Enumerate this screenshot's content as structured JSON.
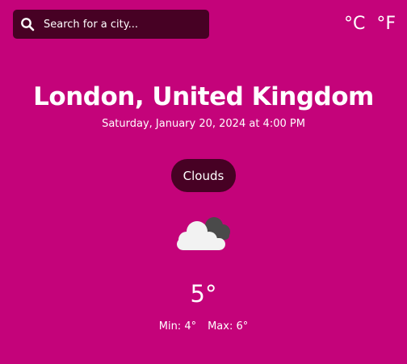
{
  "search": {
    "placeholder": "Search for a city...",
    "icon": "search-icon"
  },
  "units": {
    "celsius": "°C",
    "fahrenheit": "°F"
  },
  "weather": {
    "location": "London, United Kingdom",
    "datetime": "Saturday, January 20, 2024 at 4:00 PM",
    "condition": "Clouds",
    "icon": "cloud-icon",
    "temperature": "5°",
    "min": "Min: 4°",
    "max": "Max: 6°"
  },
  "colors": {
    "background": "#c4037a",
    "accent": "#470124",
    "text": "#ffffff"
  }
}
